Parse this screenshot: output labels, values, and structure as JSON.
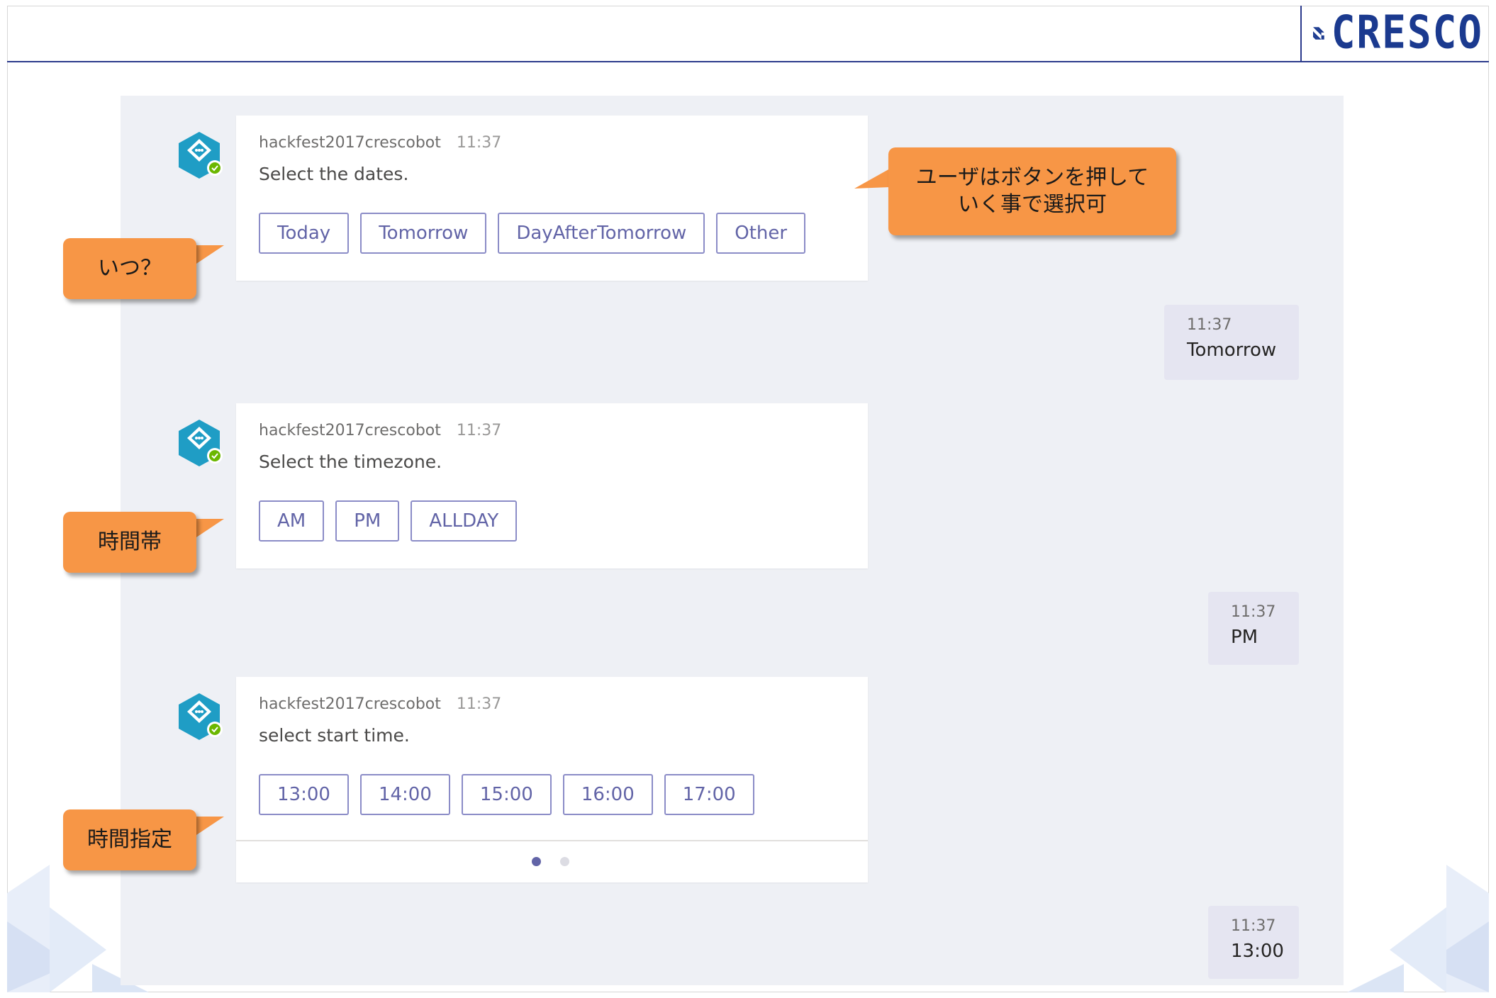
{
  "brand": {
    "name": "CRESCO",
    "color": "#1b3a8f"
  },
  "colors": {
    "accent": "#6264a7",
    "callout": "#f79646",
    "panel": "#eef0f5",
    "user_bubble": "#e5e5f1"
  },
  "messages": [
    {
      "sender": "hackfest2017crescobot",
      "time": "11:37",
      "text": "Select the dates.",
      "buttons": [
        "Today",
        "Tomorrow",
        "DayAfterTomorrow",
        "Other"
      ]
    },
    {
      "time": "11:37",
      "text": "Tomorrow"
    },
    {
      "sender": "hackfest2017crescobot",
      "time": "11:37",
      "text": "Select the timezone.",
      "buttons": [
        "AM",
        "PM",
        "ALLDAY"
      ]
    },
    {
      "time": "11:37",
      "text": "PM"
    },
    {
      "sender": "hackfest2017crescobot",
      "time": "11:37",
      "text": "select start time.",
      "buttons": [
        "13:00",
        "14:00",
        "15:00",
        "16:00",
        "17:00"
      ],
      "carousel": {
        "pages": 2,
        "active": 1
      }
    },
    {
      "time": "11:37",
      "text": "13:00"
    }
  ],
  "callouts": {
    "buttons_note": [
      "ユーザはボタンを押して",
      "いく事で選択可"
    ],
    "when": "いつ？",
    "timezone": "時間帯",
    "time_spec": "時間指定"
  }
}
